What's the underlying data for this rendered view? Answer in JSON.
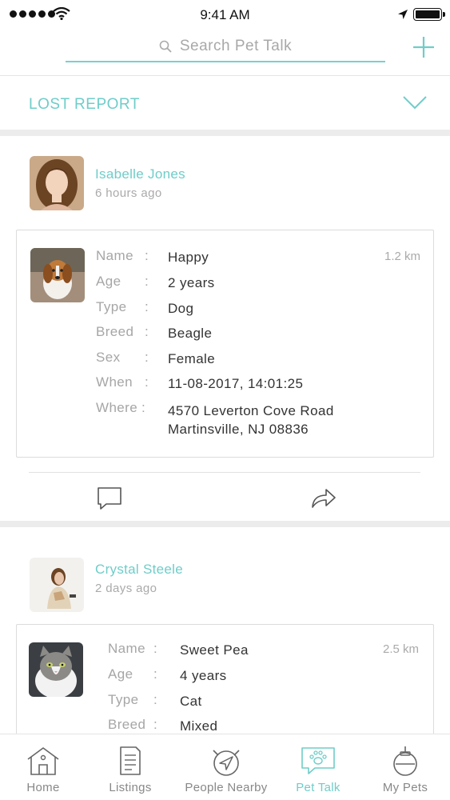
{
  "status_bar": {
    "time": "9:41 AM"
  },
  "search": {
    "placeholder": "Search Pet Talk"
  },
  "section": {
    "title": "LOST REPORT"
  },
  "posts": [
    {
      "user": "Isabelle Jones",
      "time": "6 hours ago",
      "distance": "1.2 km",
      "fields": [
        {
          "key": "Name",
          "value": "Happy"
        },
        {
          "key": "Age",
          "value": "2 years"
        },
        {
          "key": "Type",
          "value": "Dog"
        },
        {
          "key": "Breed",
          "value": "Beagle"
        },
        {
          "key": "Sex",
          "value": "Female"
        },
        {
          "key": "When",
          "value": "11-08-2017, 14:01:25"
        },
        {
          "key": "Where",
          "value": "4570 Leverton Cove Road",
          "value2": "Martinsville, NJ 08836"
        }
      ]
    },
    {
      "user": "Crystal Steele",
      "time": "2 days ago",
      "distance": "2.5 km",
      "fields": [
        {
          "key": "Name",
          "value": "Sweet Pea"
        },
        {
          "key": "Age",
          "value": "4 years"
        },
        {
          "key": "Type",
          "value": "Cat"
        },
        {
          "key": "Breed",
          "value": "Mixed"
        }
      ]
    }
  ],
  "separator": ":",
  "tabs": [
    {
      "label": "Home",
      "icon": "home-icon"
    },
    {
      "label": "Listings",
      "icon": "listings-icon"
    },
    {
      "label": "People Nearby",
      "icon": "people-nearby-icon"
    },
    {
      "label": "Pet Talk",
      "icon": "paw-chat-icon",
      "active": true
    },
    {
      "label": "My Pets",
      "icon": "my-pets-icon"
    }
  ],
  "colors": {
    "accent": "#6ecdc9",
    "divider": "#ececec"
  }
}
